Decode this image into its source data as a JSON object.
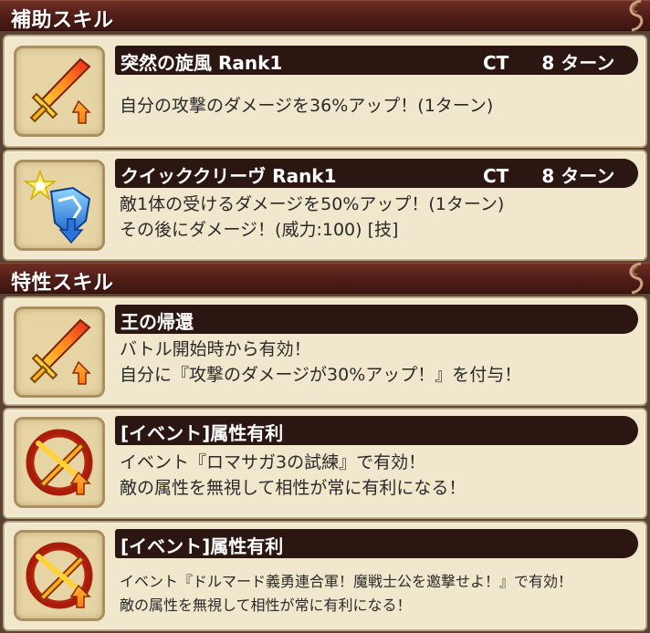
{
  "sections": {
    "support_title": "補助スキル",
    "trait_title": "特性スキル"
  },
  "support_skills": [
    {
      "icon": "sword-attack-up-icon",
      "name": "突然の旋風",
      "rank": "Rank1",
      "ct_label": "CT",
      "ct_value": "8 ターン",
      "desc": [
        "自分の攻撃のダメージを36%アップ！(1ターン)"
      ]
    },
    {
      "icon": "shield-damage-up-icon",
      "name": "クイッククリーヴ",
      "rank": "Rank1",
      "ct_label": "CT",
      "ct_value": "8 ターン",
      "desc": [
        "敵1体の受けるダメージを50%アップ！(1ターン)",
        "その後にダメージ！(威力:100) [技]"
      ]
    }
  ],
  "trait_skills": [
    {
      "icon": "sword-attack-up-icon",
      "name": "王の帰還",
      "desc": [
        "バトル開始時から有効！",
        "自分に『攻撃のダメージが30%アップ！』を付与！"
      ]
    },
    {
      "icon": "attribute-advantage-icon",
      "name": "[イベント]属性有利",
      "desc": [
        "イベント『ロマサガ3の試練』で有効！",
        "敵の属性を無視して相性が常に有利になる！"
      ]
    },
    {
      "icon": "attribute-advantage-icon",
      "name": "[イベント]属性有利",
      "desc": [
        "イベント『ドルマード義勇連合軍！魔戦士公を邀撃せよ！』で有効！",
        "敵の属性を無視して相性が常に有利になる！"
      ]
    }
  ]
}
